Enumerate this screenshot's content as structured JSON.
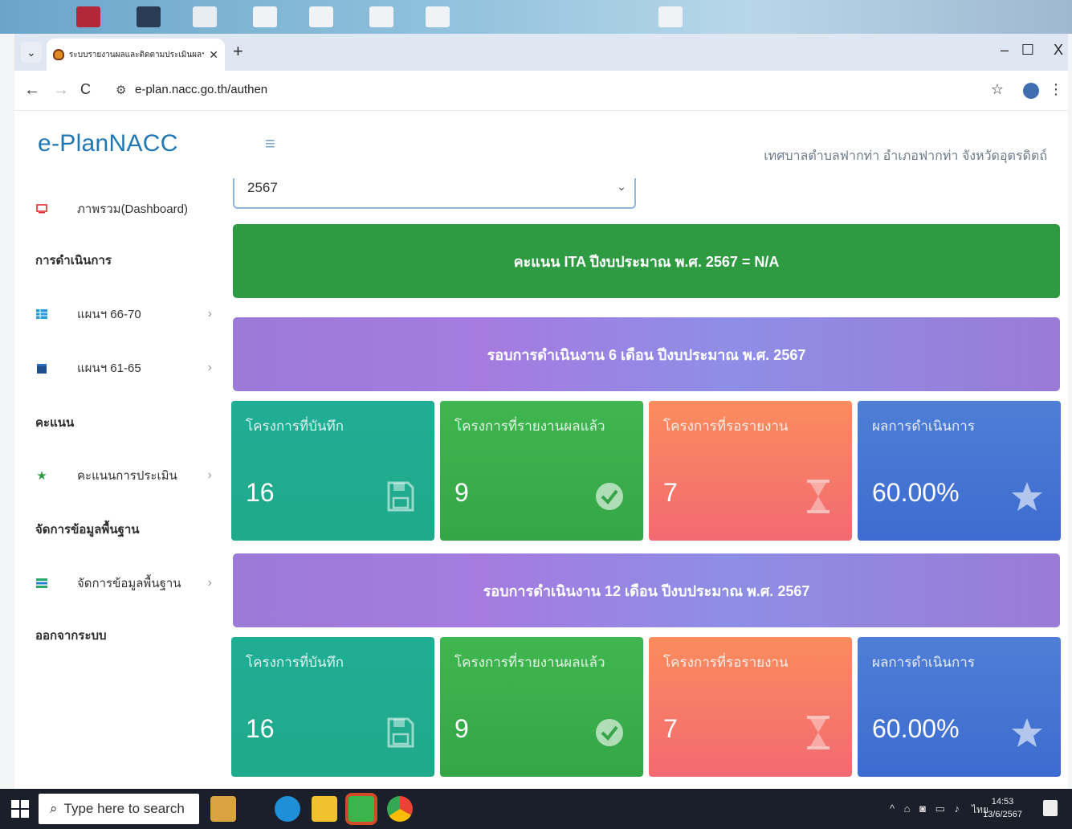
{
  "browser": {
    "tab_title": "ระบบรายงานผลและติดตามประเมินผลฯ",
    "url": "e-plan.nacc.go.th/authen"
  },
  "app": {
    "brand": "e-PlanNACC",
    "organization": "เทศบาลตำบลฟากท่า อำเภอฟากท่า จังหวัดอุตรดิตถ์"
  },
  "sidebar": {
    "dashboard": "ภาพรวม(Dashboard)",
    "section_operations": "การดำเนินการ",
    "plan_66_70": "แผนฯ 66-70",
    "plan_61_65": "แผนฯ 61-65",
    "section_score": "คะแนน",
    "assessment_score": "คะแนนการประเมิน",
    "section_basedata": "จัดการข้อมูลพื้นฐาน",
    "basedata": "จัดการข้อมูลพื้นฐาน",
    "logout": "ออกจากระบบ"
  },
  "main": {
    "year": "2567",
    "ita_banner": "คะแนน ITA ปีงบประมาณ พ.ศ. 2567 = N/A",
    "round6": {
      "title": "รอบการดำเนินงาน 6 เดือน ปีงบประมาณ พ.ศ. 2567",
      "recorded_label": "โครงการที่บันทึก",
      "recorded_value": "16",
      "reported_label": "โครงการที่รายงานผลแล้ว",
      "reported_value": "9",
      "pending_label": "โครงการที่รอรายงาน",
      "pending_value": "7",
      "result_label": "ผลการดำเนินการ",
      "result_value": "60.00%"
    },
    "round12": {
      "title": "รอบการดำเนินงาน 12 เดือน ปีงบประมาณ พ.ศ. 2567",
      "recorded_label": "โครงการที่บันทึก",
      "recorded_value": "16",
      "reported_label": "โครงการที่รายงานผลแล้ว",
      "reported_value": "9",
      "pending_label": "โครงการที่รอรายงาน",
      "pending_value": "7",
      "result_label": "ผลการดำเนินการ",
      "result_value": "60.00%"
    }
  },
  "taskbar": {
    "search_placeholder": "Type here to search",
    "lang": "ไทย",
    "time": "14:53",
    "date": "13/6/2567"
  }
}
